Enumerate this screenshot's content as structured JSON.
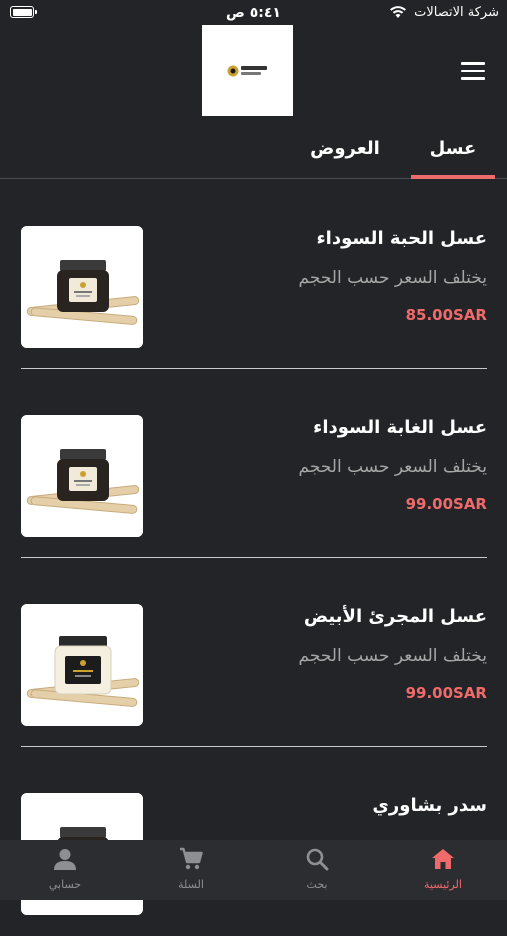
{
  "status_bar": {
    "carrier": "شركة الاتصالات",
    "time": "٥:٤١ ص"
  },
  "header": {
    "logo_icon": "nahla-logo",
    "logo_text": "نحلة Nahla",
    "menu_icon": "hamburger-icon"
  },
  "tabs": [
    {
      "label": "عسل",
      "active": true
    },
    {
      "label": "العروض",
      "active": false
    }
  ],
  "products": [
    {
      "name": "عسل الحبة السوداء",
      "description": "يختلف السعر حسب الحجم",
      "price": "85.00SAR",
      "jar_color": "dark"
    },
    {
      "name": "عسل الغابة السوداء",
      "description": "يختلف السعر حسب الحجم",
      "price": "99.00SAR",
      "jar_color": "dark"
    },
    {
      "name": "عسل المجرئ الأبيض",
      "description": "يختلف السعر حسب الحجم",
      "price": "99.00SAR",
      "jar_color": "light"
    },
    {
      "name": "سدر بشاوري",
      "description": "",
      "price": "",
      "jar_color": "dark"
    }
  ],
  "bottom_nav": [
    {
      "label": "الرئيسية",
      "icon": "home-icon",
      "active": true
    },
    {
      "label": "بحث",
      "icon": "search-icon",
      "active": false
    },
    {
      "label": "السلة",
      "icon": "cart-icon",
      "active": false
    },
    {
      "label": "حسابي",
      "icon": "user-icon",
      "active": false
    }
  ],
  "colors": {
    "background": "#232427",
    "accent": "#ef6b6b",
    "muted_text": "#a6a6a6",
    "nav_background": "#2c2d31"
  }
}
